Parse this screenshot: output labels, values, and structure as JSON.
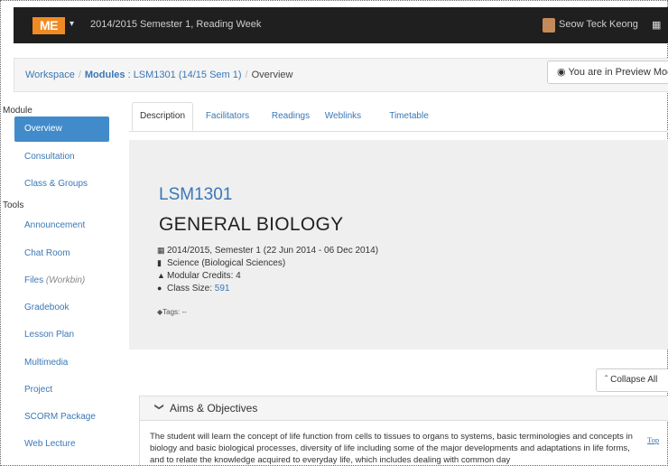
{
  "header": {
    "logo": "ME",
    "logo_caret": "▾",
    "term": "2014/2015 Semester 1, Reading Week",
    "user_name": "Seow Teck Keong",
    "grid_icon": "grid-icon"
  },
  "breadcrumb": {
    "workspace": "Workspace",
    "sep1": "/",
    "modules_label": "Modules",
    "colon": " : ",
    "module_link": "LSM1301 (14/15 Sem 1)",
    "sep2": "/",
    "current": "Overview"
  },
  "preview_button": "You are in Preview Mode",
  "sidebar": {
    "module_heading": "Module",
    "tools_heading": "Tools",
    "module_items": [
      {
        "label": "Overview"
      },
      {
        "label": "Consultation"
      },
      {
        "label": "Class & Groups"
      }
    ],
    "tool_items": [
      {
        "label": "Announcement"
      },
      {
        "label": "Chat Room"
      },
      {
        "label": "Files",
        "suffix": "(Workbin)"
      },
      {
        "label": "Gradebook"
      },
      {
        "label": "Lesson Plan"
      },
      {
        "label": "Multimedia"
      },
      {
        "label": "Project"
      },
      {
        "label": "SCORM Package"
      },
      {
        "label": "Web Lecture"
      }
    ]
  },
  "tabs": [
    "Description",
    "Facilitators",
    "Readings",
    "Weblinks",
    "Timetable"
  ],
  "module": {
    "code": "LSM1301",
    "title": "GENERAL BIOLOGY",
    "semester": "2014/2015, Semester 1   (22 Jun 2014 - 06 Dec 2014)",
    "faculty": "Science (Biological Sciences)",
    "credits": "Modular Credits: 4",
    "class_size_label": "Class Size: ",
    "class_size_value": "591",
    "tags": "Tags: --"
  },
  "collapse_all": "Collapse All",
  "aims": {
    "heading": "Aims & Objectives",
    "text": "The student will learn the concept of life function from cells to tissues to organs to systems, basic terminologies and concepts in biology and basic biological processes, diversity of life including some of the major developments and adaptations in life forms, and to relate the knowledge acquired to everyday life, which includes dealing with common day",
    "top_link": "Top"
  },
  "colors": {
    "accent": "#428bca",
    "link": "#3a77b5",
    "logo": "#f08a24",
    "topbar": "#1f1f1f"
  }
}
